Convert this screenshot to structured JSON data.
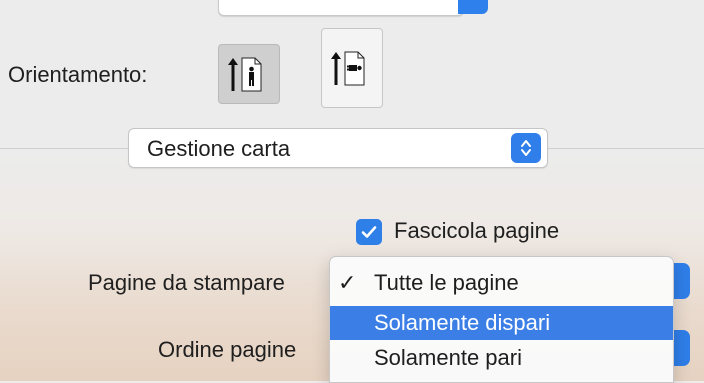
{
  "orientation": {
    "label": "Orientamento:",
    "options": [
      {
        "icon": "portrait-orientation-icon",
        "selected": true
      },
      {
        "icon": "landscape-orientation-icon",
        "selected": false
      }
    ]
  },
  "section_popup": {
    "value": "Gestione carta"
  },
  "collate": {
    "label": "Fascicola pagine",
    "checked": true
  },
  "pages_to_print": {
    "label": "Pagine da stampare",
    "menu": [
      {
        "label": "Tutte le pagine",
        "checked": true,
        "highlighted": false
      },
      {
        "label": "Solamente dispari",
        "checked": false,
        "highlighted": true
      },
      {
        "label": "Solamente pari",
        "checked": false,
        "highlighted": false
      }
    ],
    "checkmark": "✓"
  },
  "page_order": {
    "label": "Ordine pagine"
  },
  "colors": {
    "accent": "#2e80ec",
    "highlight": "#3a7ee6"
  }
}
